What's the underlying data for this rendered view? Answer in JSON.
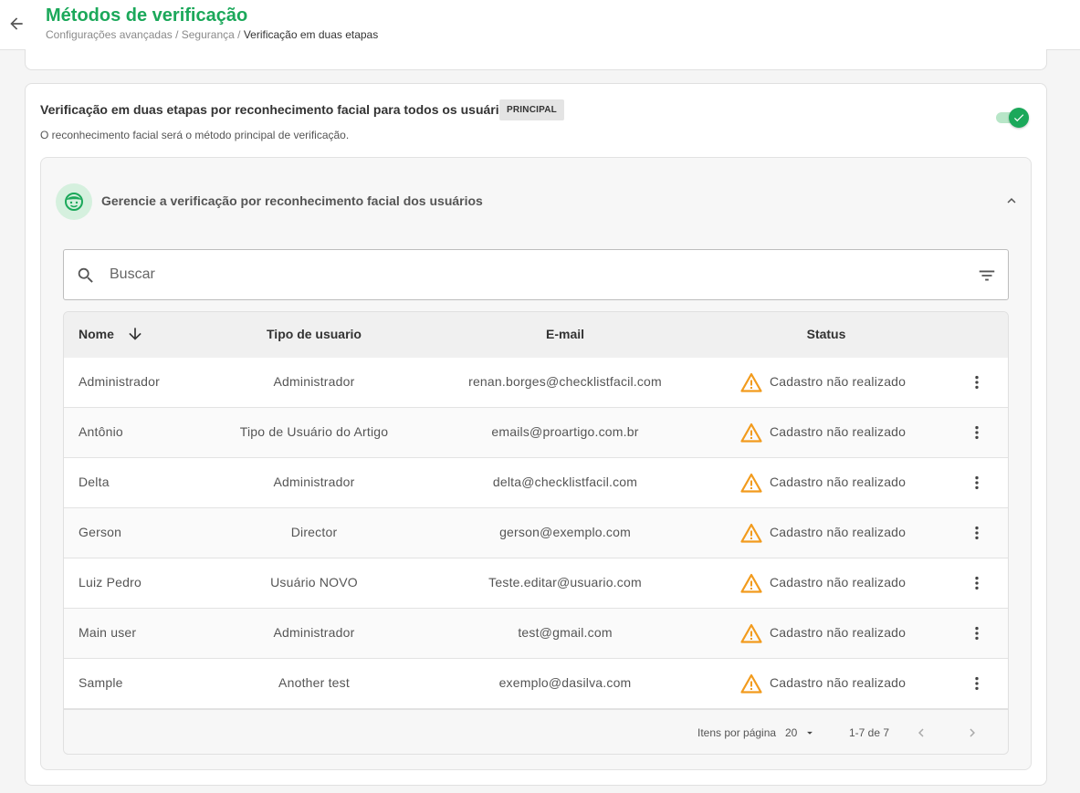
{
  "header": {
    "title": "Métodos de verificação",
    "breadcrumb": {
      "path": "Configurações avançadas / Segurança / ",
      "current": "Verificação em duas etapas"
    }
  },
  "card": {
    "title": "Verificação em duas etapas por reconhecimento facial para todos os usuários",
    "badge": "PRINCIPAL",
    "subtitle": "O reconhecimento facial será o método principal de verificação.",
    "toggle_on": true
  },
  "section": {
    "title": "Gerencie a verificação por reconhecimento facial dos usuários"
  },
  "search": {
    "placeholder": "Buscar"
  },
  "table": {
    "columns": {
      "nome": "Nome",
      "tipo": "Tipo de usuario",
      "email": "E-mail",
      "status": "Status"
    },
    "rows": [
      {
        "nome": "Administrador",
        "tipo": "Administrador",
        "email": "renan.borges@checklistfacil.com",
        "status": "Cadastro não realizado"
      },
      {
        "nome": "Antônio",
        "tipo": "Tipo de Usuário do Artigo",
        "email": "emails@proartigo.com.br",
        "status": "Cadastro não realizado"
      },
      {
        "nome": "Delta",
        "tipo": "Administrador",
        "email": "delta@checklistfacil.com",
        "status": "Cadastro não realizado"
      },
      {
        "nome": "Gerson",
        "tipo": "Director",
        "email": "gerson@exemplo.com",
        "status": "Cadastro não realizado"
      },
      {
        "nome": "Luiz Pedro",
        "tipo": "Usuário NOVO",
        "email": "Teste.editar@usuario.com",
        "status": "Cadastro não realizado"
      },
      {
        "nome": "Main user",
        "tipo": "Administrador",
        "email": "test@gmail.com",
        "status": "Cadastro não realizado"
      },
      {
        "nome": "Sample",
        "tipo": "Another test",
        "email": "exemplo@dasilva.com",
        "status": "Cadastro não realizado"
      }
    ]
  },
  "pagination": {
    "per_page_label": "Itens por página",
    "per_page_value": "20",
    "range": "1-7 de 7"
  },
  "colors": {
    "brand_green": "#1ba85a",
    "warning_orange": "#f29b1d"
  },
  "icons": [
    "arrow-left-icon",
    "check-icon",
    "face-icon",
    "chevron-up-icon",
    "search-icon",
    "filter-icon",
    "arrow-down-icon",
    "warning-icon",
    "more-vert-icon",
    "caret-down-icon",
    "chevron-left-icon",
    "chevron-right-icon"
  ]
}
